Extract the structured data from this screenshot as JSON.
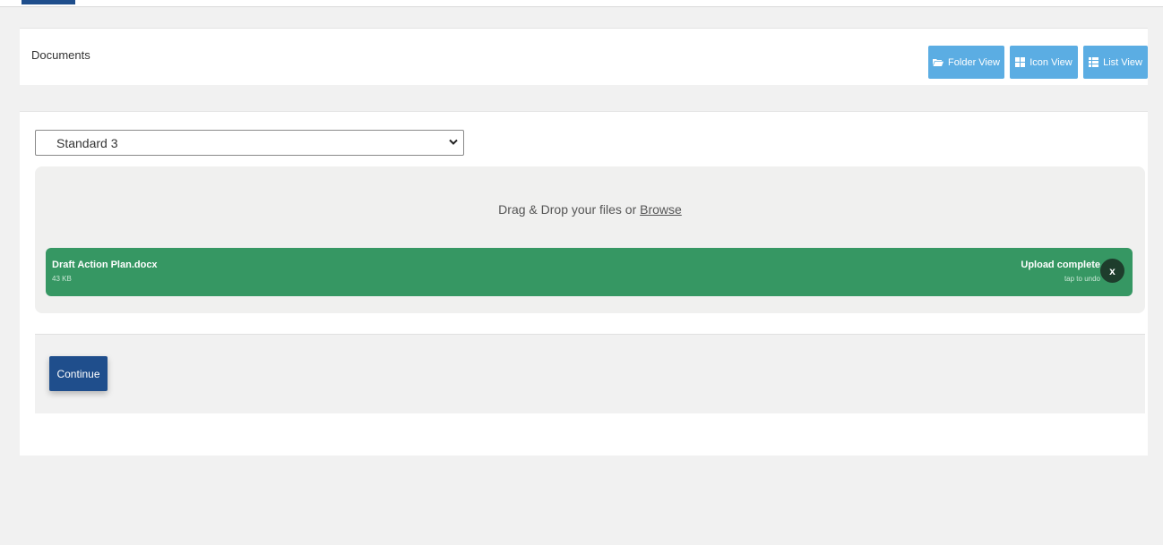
{
  "header": {
    "title": "Documents",
    "views": {
      "folder": {
        "label": "Folder View",
        "icon": "folder-open-icon"
      },
      "icon": {
        "label": "Icon View",
        "icon": "grid-icon"
      },
      "list": {
        "label": "List View",
        "icon": "list-icon"
      }
    }
  },
  "standard_select": {
    "value": "Standard 3"
  },
  "dropzone": {
    "label": "Drag & Drop your files or",
    "browse_label": "Browse",
    "file": {
      "name": "Draft Action Plan.docx",
      "size": "43 KB",
      "status": "Upload complete",
      "undo_hint": "tap to undo",
      "remove_label": "x"
    }
  },
  "actions": {
    "continue_label": "Continue"
  },
  "colors": {
    "primary": "#1f4e8c",
    "view_button": "#5bade3",
    "upload_success": "#369763",
    "page_background": "#f1f1f1"
  }
}
